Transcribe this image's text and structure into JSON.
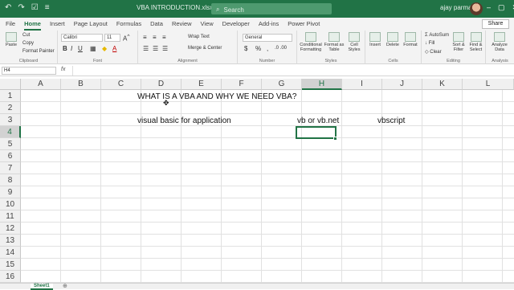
{
  "titlebar": {
    "doc_title": "VBA INTRODUCTION.xlsx",
    "search_placeholder": "Search",
    "user_name": "ajay parmar"
  },
  "tabs": [
    "File",
    "Home",
    "Insert",
    "Page Layout",
    "Formulas",
    "Data",
    "Review",
    "View",
    "Developer",
    "Add-ins",
    "Power Pivot"
  ],
  "share_label": "Share",
  "ribbon": {
    "clipboard": {
      "paste": "Paste",
      "cut": "Cut",
      "copy": "Copy",
      "format_painter": "Format Painter",
      "label": "Clipboard"
    },
    "font": {
      "name": "Calibri",
      "size": "11",
      "label": "Font"
    },
    "alignment": {
      "wrap_text": "Wrap Text",
      "merge_center": "Merge & Center",
      "label": "Alignment"
    },
    "number": {
      "format": "General",
      "label": "Number"
    },
    "styles": {
      "conditional": "Conditional Formatting",
      "format_table": "Format as Table",
      "cell_styles": "Cell Styles",
      "label": "Styles"
    },
    "cells": {
      "insert": "Insert",
      "delete": "Delete",
      "format": "Format",
      "label": "Cells"
    },
    "editing": {
      "autosum": "AutoSum",
      "fill": "Fill",
      "clear": "Clear",
      "sort_filter": "Sort & Filter",
      "find_select": "Find & Select",
      "label": "Editing"
    },
    "analysis": {
      "analyze": "Analyze Data",
      "label": "Analysis"
    }
  },
  "namebox": "H4",
  "fx_label": "fx",
  "columns": [
    "A",
    "B",
    "C",
    "D",
    "E",
    "F",
    "G",
    "H",
    "I",
    "J",
    "K",
    "L"
  ],
  "rows": [
    "1",
    "2",
    "3",
    "4",
    "5",
    "6",
    "7",
    "8",
    "9",
    "10",
    "11",
    "12",
    "13",
    "14",
    "15",
    "16"
  ],
  "cells": {
    "D1": "WHAT IS  A VBA AND WHY WE NEED VBA?",
    "D3": "visual basic for application",
    "H3": "vb or vb.net",
    "J3": "vbscript"
  },
  "sheet_tab": "Sheet1"
}
